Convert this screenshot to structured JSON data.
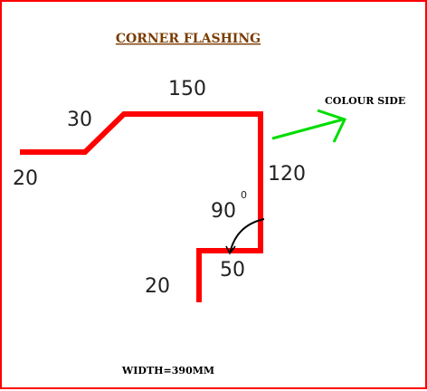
{
  "title": "CORNER  FLASHING",
  "colour_side_label": "COLOUR  SIDE",
  "width_label": "WIDTH=390MM",
  "dimensions": {
    "left_leg": "20",
    "slope": "30",
    "top": "150",
    "vertical": "120",
    "angle": "90",
    "angle_unit": "0",
    "bottom_return": "50",
    "bottom_leg": "20"
  },
  "colors": {
    "border": "#ff0000",
    "flashing": "#ff0000",
    "arrow": "#00dd00",
    "title": "#7a3b00",
    "angle_arc": "#000000"
  }
}
